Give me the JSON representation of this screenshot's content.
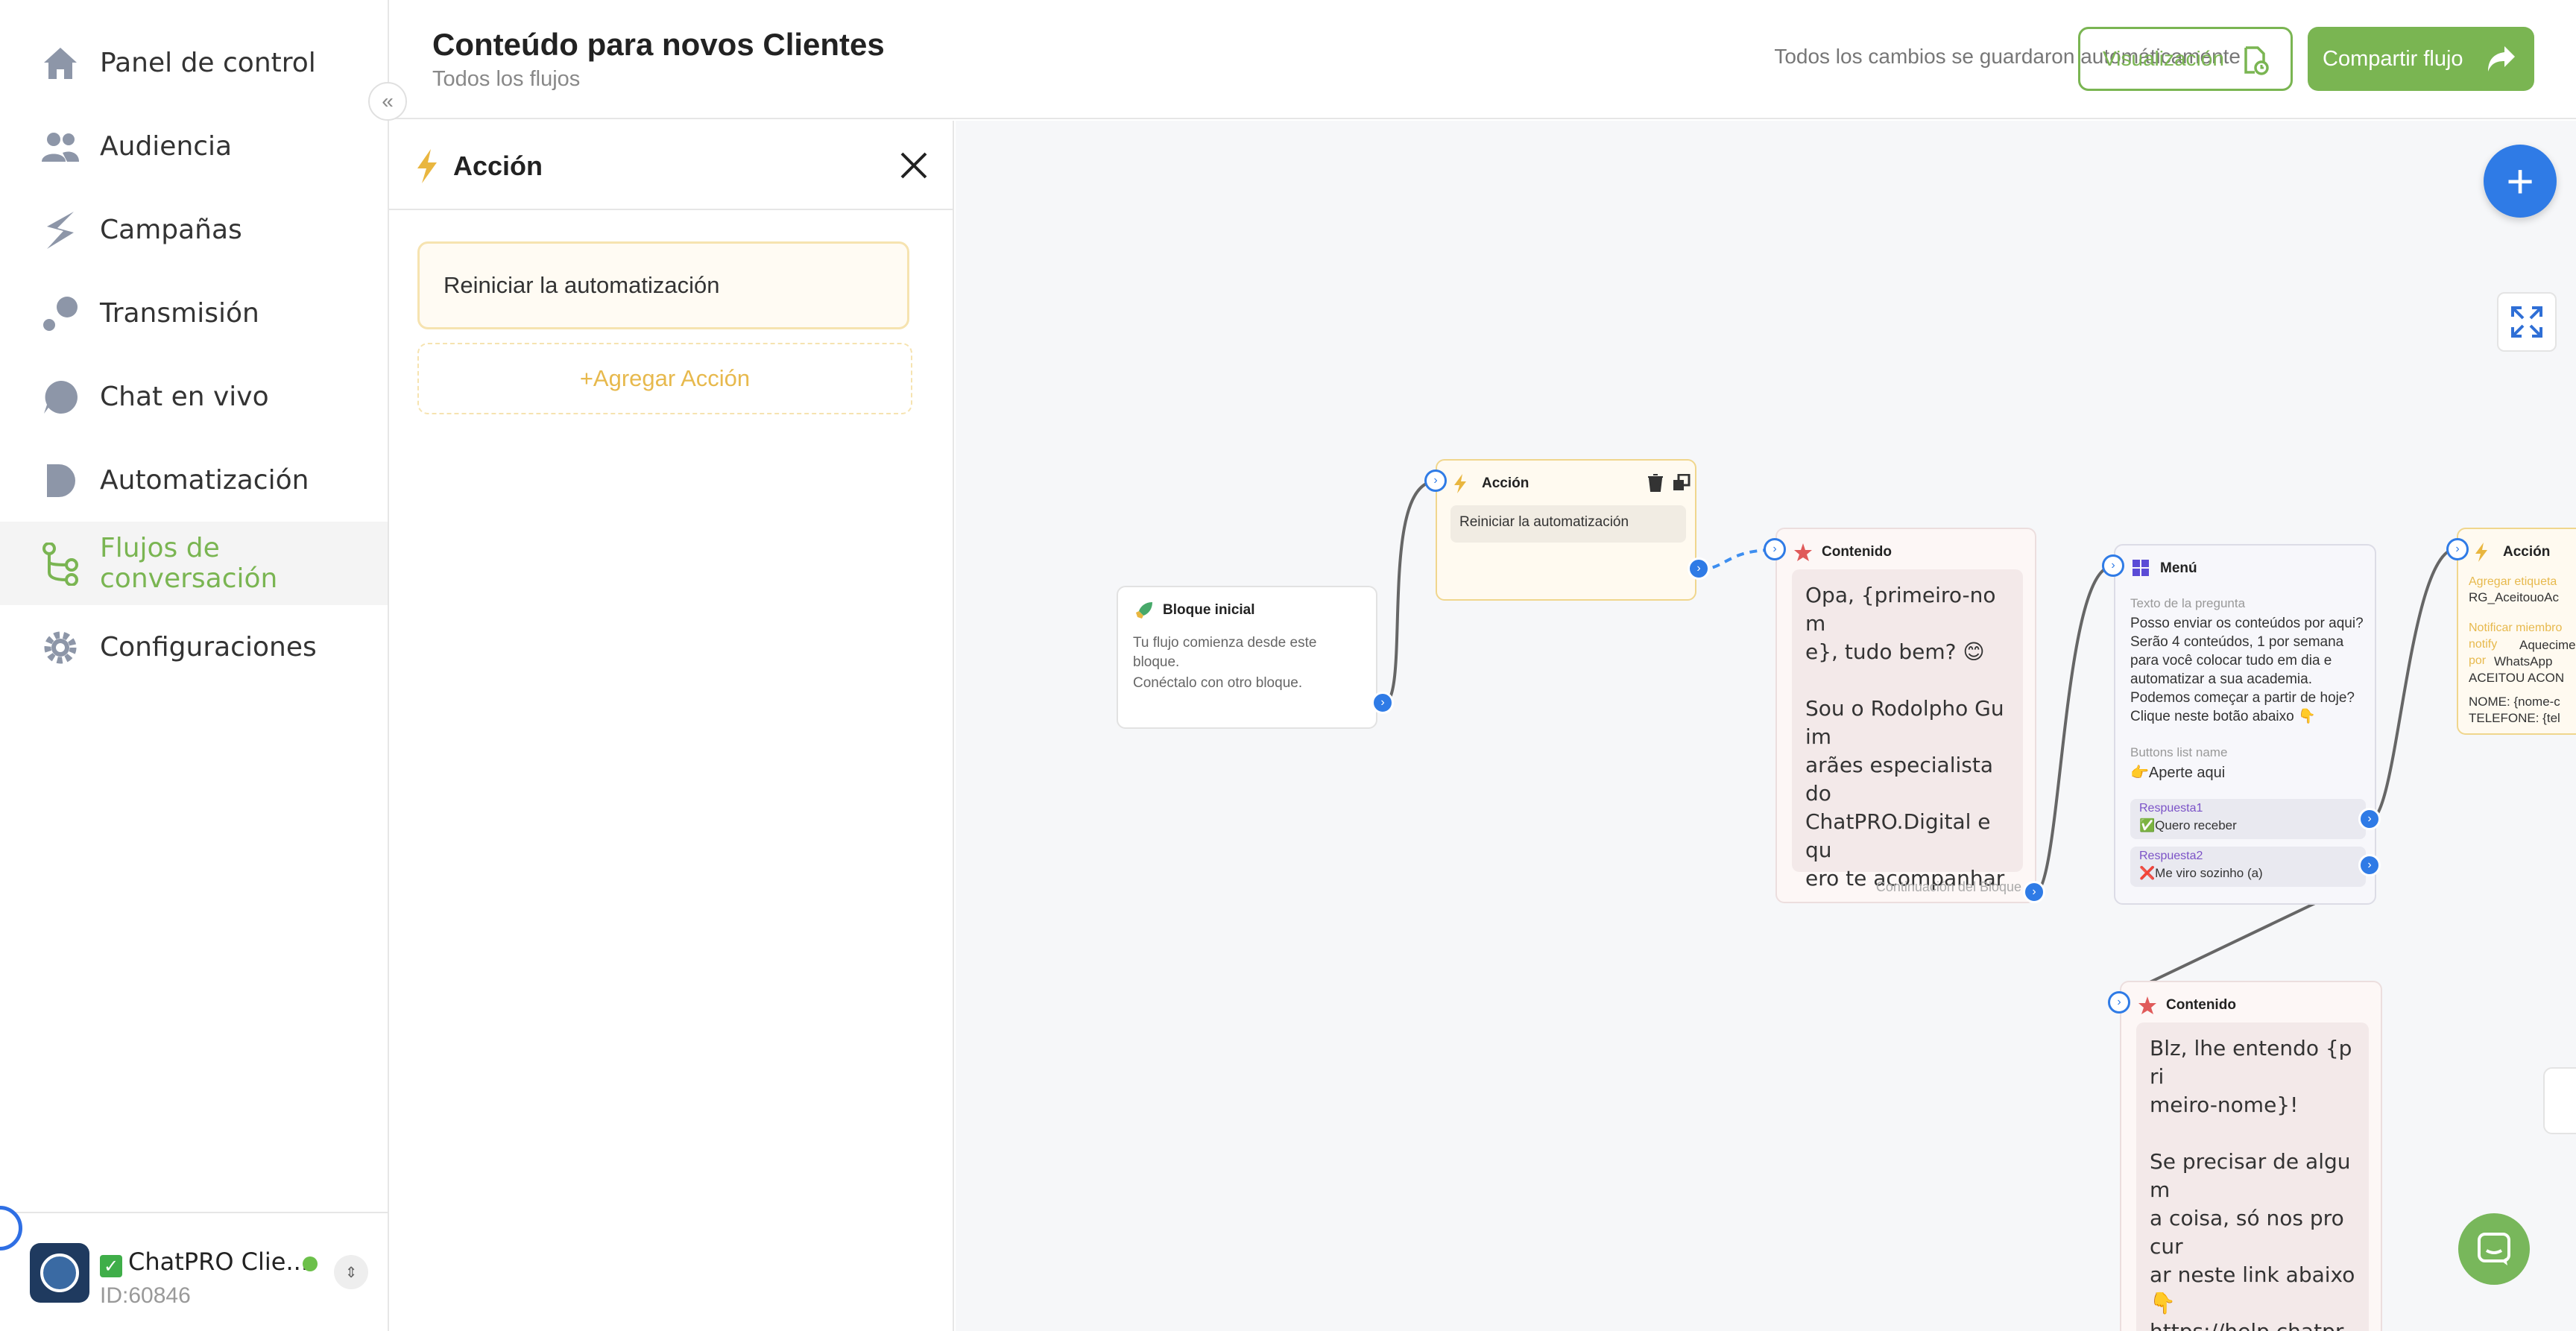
{
  "sidebar": {
    "items": [
      {
        "label": "Panel de control",
        "icon": "home-icon"
      },
      {
        "label": "Audiencia",
        "icon": "users-icon"
      },
      {
        "label": "Campañas",
        "icon": "campaign-icon"
      },
      {
        "label": "Transmisión",
        "icon": "broadcast-icon"
      },
      {
        "label": "Chat en vivo",
        "icon": "chat-icon"
      },
      {
        "label": "Automatización",
        "icon": "automation-icon"
      },
      {
        "label": "Flujos de conversación",
        "icon": "flow-icon"
      },
      {
        "label": "Configuraciones",
        "icon": "gear-icon"
      }
    ],
    "active_index": 6,
    "account": {
      "name": "ChatPRO Clie...",
      "id": "ID:60846"
    }
  },
  "header": {
    "title": "Conteúdo para novos Clientes",
    "breadcrumb": "Todos los flujos",
    "saved_status": "Todos los cambios se guardaron automáticamente",
    "preview_label": "Visualización",
    "share_label": "Compartir flujo"
  },
  "panel": {
    "title": "Acción",
    "action_item": "Reiniciar la automatización",
    "add_action": "+Agregar Acción"
  },
  "canvas": {
    "start_node": {
      "title": "Bloque inicial",
      "line1": "Tu flujo comienza desde este",
      "line2": "bloque.",
      "line3": "Conéctalo con otro bloque."
    },
    "action_node": {
      "title": "Acción",
      "item": "Reiniciar la automatización"
    },
    "content_node": {
      "title": "Contenido",
      "message": "Opa, {primeiro-nom\ne}, tudo bem? 😊\n\nSou o Rodolpho Guim\narães especialista do\nChatPRO.Digital e qu\nero te acompanhar ne\nssa jornada de autom\natizar a sua Academi\na, pode ser?",
      "footer": "Continuación del Bloque"
    },
    "menu_node": {
      "title": "Menú",
      "question_label": "Texto de la pregunta",
      "question": "Posso enviar os conteúdos por aqui? Serão 4 conteúdos, 1 por semana para você colocar tudo em dia e automatizar a sua academia. Podemos começar a partir de hoje? Clique neste botão abaixo 👇",
      "list_label": "Buttons list name",
      "list_name": "👉Aperte aqui",
      "replies": [
        {
          "label": "Respuesta1",
          "text": "✅Quero receber"
        },
        {
          "label": "Respuesta2",
          "text": "❌Me viro sozinho (a)"
        }
      ]
    },
    "action_node2": {
      "title": "Acción",
      "tag_label": "Agregar etiqueta",
      "tag_value": "RG_AceitouoAc",
      "notify_label1": "Notificar miembro",
      "notify_value1": "Aquecime",
      "notify_label2": "notify",
      "notify_label3": "por",
      "notify_value3": "WhatsApp",
      "notify_value4": "ACEITOU ACON",
      "name_line": "NOME: {nome-c",
      "phone_line": "TELEFONE: {tel"
    },
    "content_node2": {
      "title": "Contenido",
      "message": "Blz, lhe entendo {pri\nmeiro-nome}!\n\nSe precisar de algum\na coisa, só nos procur\nar neste link abaixo\n👇\nhttps://help.chatpro.di\ngital/pt\n\nTe espero no suporte"
    }
  },
  "colors": {
    "brand_green": "#7ab552",
    "accent_blue": "#2f7be6",
    "action_yellow": "#f0d68d"
  }
}
